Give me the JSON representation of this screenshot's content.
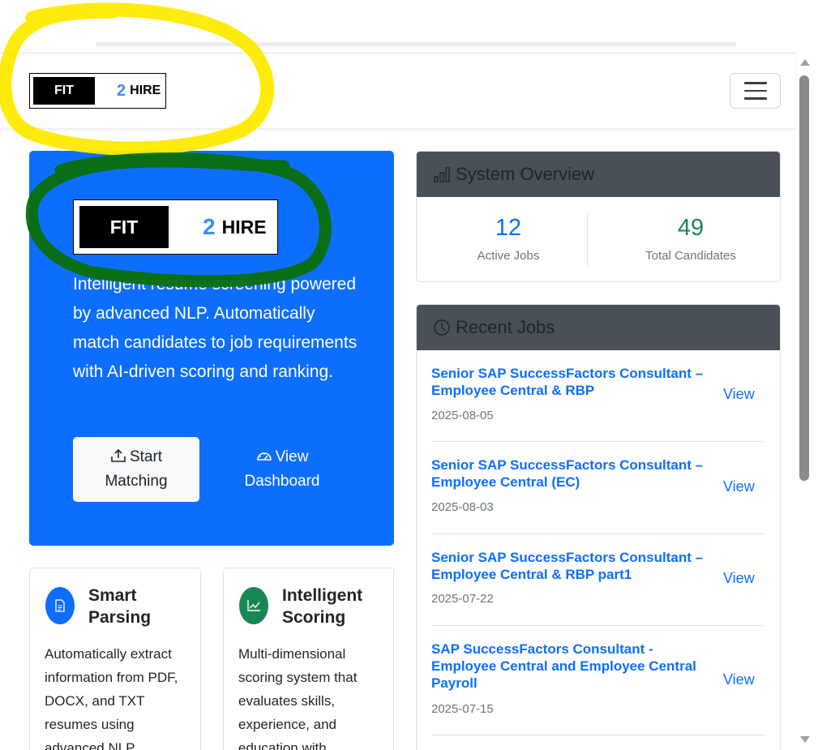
{
  "navbar": {
    "brand": {
      "fit": "FIT",
      "two": "2",
      "hire": "HIRE"
    },
    "menu_icon": "hamburger-menu-icon"
  },
  "hero": {
    "brand": {
      "fit": "FIT",
      "two": "2",
      "hire": "HIRE"
    },
    "description": "Intelligent resume screening powered by advanced NLP. Automatically match candidates to job requirements with AI-driven scoring and ranking.",
    "start_button": {
      "line1": "Start",
      "line2": "Matching",
      "icon": "upload-icon"
    },
    "dashboard_button": {
      "line1": "View",
      "line2": "Dashboard",
      "icon": "speedometer-icon"
    },
    "color": "#0d6efd"
  },
  "features": [
    {
      "title_line1": "Smart",
      "title_line2": "Parsing",
      "icon": "document-icon",
      "color": "#0d6efd",
      "description": "Automatically extract information from PDF, DOCX, and TXT resumes using advanced NLP"
    },
    {
      "title_line1": "Intelligent",
      "title_line2": "Scoring",
      "icon": "graph-up-icon",
      "color": "#198754",
      "description": "Multi-dimensional scoring system that evaluates skills, experience, and education with"
    }
  ],
  "overview": {
    "title": "System Overview",
    "icon": "bar-chart-icon",
    "stats": [
      {
        "value": "12",
        "label": "Active Jobs",
        "color": "#0d6efd"
      },
      {
        "value": "49",
        "label": "Total Candidates",
        "color": "#198754"
      }
    ]
  },
  "recent_jobs": {
    "title": "Recent Jobs",
    "icon": "clock-icon",
    "view_label": "View",
    "jobs": [
      {
        "title_line1": "Senior SAP SuccessFactors Consultant –",
        "title_line2": "Employee Central & RBP",
        "title_line3": "",
        "date": "2025-08-05"
      },
      {
        "title_line1": "Senior SAP SuccessFactors Consultant –",
        "title_line2": "Employee Central (EC)",
        "title_line3": "",
        "date": "2025-08-03"
      },
      {
        "title_line1": "Senior SAP SuccessFactors Consultant –",
        "title_line2": "Employee Central & RBP part1",
        "title_line3": "",
        "date": "2025-07-22"
      },
      {
        "title_line1": "SAP SuccessFactors Consultant -",
        "title_line2": "Employee Central and Employee Central",
        "title_line3": "Payroll",
        "date": "2025-07-15"
      }
    ]
  },
  "annotations": {
    "highlight_yellow": "#ffea00",
    "highlight_green": "#0a6e0a"
  }
}
